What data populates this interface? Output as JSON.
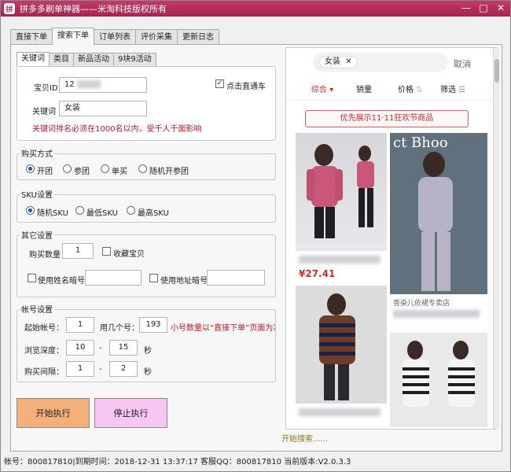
{
  "window": {
    "title": "拼多多刷单神器——米淘科技版权所有",
    "buttons": [
      "—",
      "□",
      "✕"
    ]
  },
  "tabs": [
    {
      "label": "直接下单",
      "active": false
    },
    {
      "label": "搜索下单",
      "active": true
    },
    {
      "label": "订单列表",
      "active": false
    },
    {
      "label": "评价采集",
      "active": false
    },
    {
      "label": "更新日志",
      "active": false
    }
  ],
  "subtabs": [
    {
      "label": "关键词",
      "active": true
    },
    {
      "label": "类目",
      "active": false
    },
    {
      "label": "新品活动",
      "active": false
    },
    {
      "label": "9块9活动",
      "active": false
    }
  ],
  "keyword_group": {
    "product_id_label": "宝贝ID",
    "product_id_value": "12",
    "direct_car_label": "点击直通车",
    "direct_car_checked": true,
    "keyword_label": "关键词",
    "keyword_value": "女装",
    "warning": "关键词排名必须在1000名以内，受千人千面影响"
  },
  "purchase_method": {
    "title": "购买方式",
    "options": [
      "开团",
      "参团",
      "单买",
      "随机开参团"
    ],
    "selected": 0
  },
  "sku": {
    "title": "SKU设置",
    "options": [
      "随机SKU",
      "最低SKU",
      "最高SKU"
    ],
    "selected": 0
  },
  "other": {
    "title": "其它设置",
    "quantity_label": "购买数量",
    "quantity_value": "1",
    "favorite_label": "收藏宝贝",
    "alias_label": "使用姓名暗号",
    "address_alias_label": "使用地址暗号"
  },
  "account": {
    "title": "帐号设置",
    "start_label": "起始帐号：",
    "start_value": "1",
    "count_label": "用几个号：",
    "count_value": "193",
    "count_note": "小号数量以“直接下单”页面为准",
    "browse_label": "浏览深度：",
    "browse_min": "10",
    "browse_max": "15",
    "interval_label": "购买间隔：",
    "interval_min": "1",
    "interval_max": "2",
    "dash": "-",
    "unit_sec": "秒"
  },
  "actions": {
    "start": "开始执行",
    "stop": "停止执行",
    "start_color": "#f4b07a",
    "stop_color": "#f7c6f2"
  },
  "phone": {
    "search_chip": "女装",
    "cancel": "取消",
    "filters": [
      "综合",
      "销量",
      "价格",
      "筛选"
    ],
    "promo": "优先展示11·11狂欢节商品",
    "price1": "¥27.41",
    "store_name": "香染儿依裙专卖店",
    "banner_text": "ct Bhoo"
  },
  "search_status": "开始搜索......",
  "status_bar": "帐号：800817810|到期时间：2018-12-31 13:37:17  客服QQ：800817810  当前版本:V2.0.3.3"
}
